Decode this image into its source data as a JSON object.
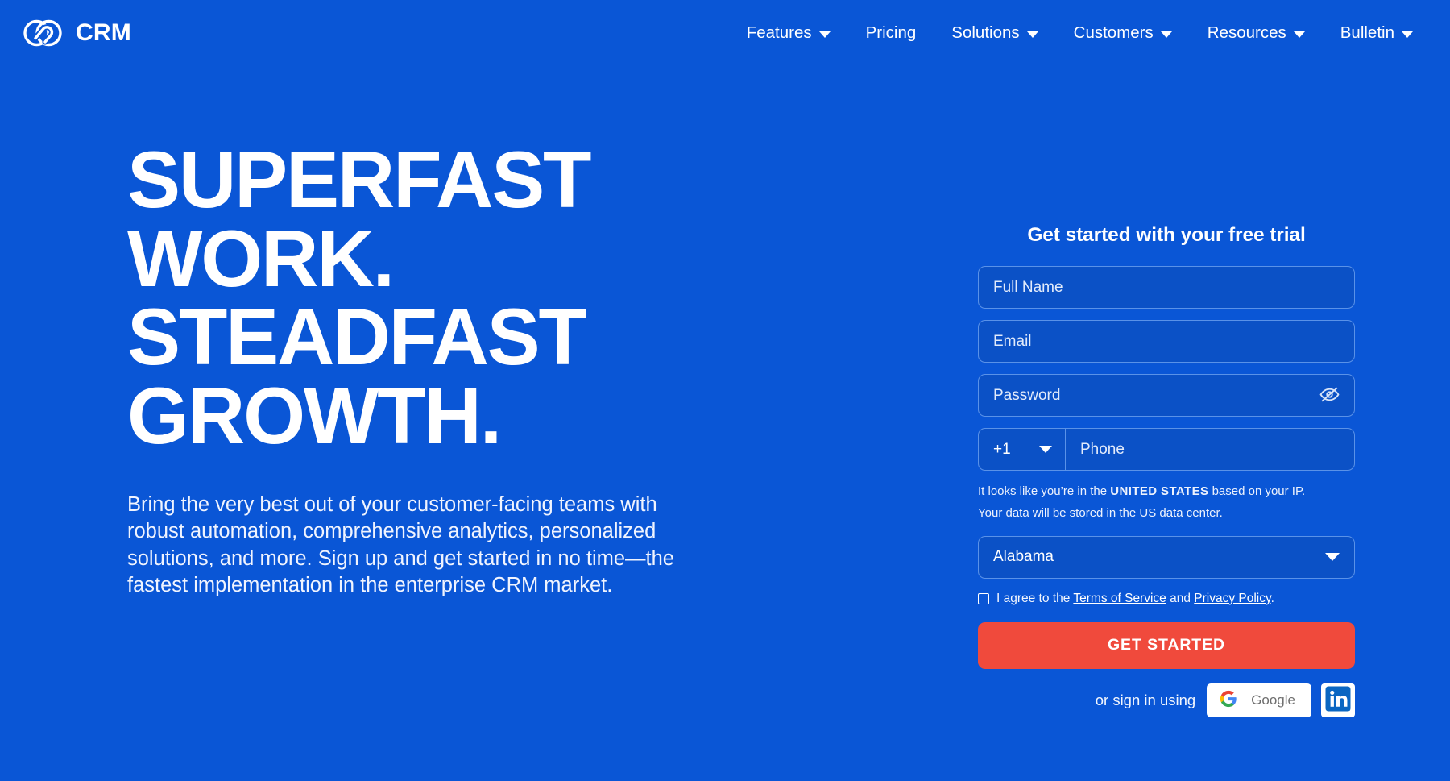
{
  "brand": {
    "name": "CRM",
    "logo_icon": "interlocking-loops-logo"
  },
  "nav": {
    "items": [
      {
        "label": "Features",
        "has_dropdown": true
      },
      {
        "label": "Pricing",
        "has_dropdown": false
      },
      {
        "label": "Solutions",
        "has_dropdown": true
      },
      {
        "label": "Customers",
        "has_dropdown": true
      },
      {
        "label": "Resources",
        "has_dropdown": true
      },
      {
        "label": "Bulletin",
        "has_dropdown": true
      }
    ]
  },
  "hero": {
    "title_lines": [
      "SUPERFAST",
      "WORK.",
      "STEADFAST",
      "GROWTH."
    ],
    "subtitle": "Bring the very best out of your customer-facing teams with robust automation, comprehensive analytics, personalized solutions, and more. Sign up and get started in no time—the fastest implementation in the enterprise CRM market."
  },
  "signup": {
    "title": "Get started with your free trial",
    "full_name": {
      "value": "",
      "placeholder": "Full Name"
    },
    "email": {
      "value": "",
      "placeholder": "Email"
    },
    "password": {
      "value": "",
      "placeholder": "Password",
      "toggle_icon": "eye-off-icon"
    },
    "country_code": {
      "value": "+1",
      "caret_icon": "chevron-down-icon"
    },
    "phone": {
      "value": "",
      "placeholder": "Phone"
    },
    "ip_note_line1_pre": "It looks like you’re in the ",
    "ip_note_country": "UNITED STATES",
    "ip_note_line1_post": " based on your IP.",
    "ip_note_line2": "Your data will be stored in the US data center.",
    "state": {
      "value": "Alabama",
      "caret_icon": "chevron-down-icon"
    },
    "terms": {
      "checked": false,
      "text_pre": "I agree to the ",
      "link_terms": "Terms of Service",
      "text_mid": " and ",
      "link_privacy": "Privacy Policy",
      "text_post": "."
    },
    "cta_label": "GET STARTED",
    "social": {
      "label": "or sign in using",
      "google_label": "Google",
      "google_icon": "google-g-icon",
      "linkedin_icon": "linkedin-in-icon"
    }
  },
  "colors": {
    "background": "#0A56D6",
    "field_fill": "#0B51C6",
    "field_border": "#5A92E8",
    "cta": "#F04A3C",
    "text": "#FFFFFF"
  }
}
